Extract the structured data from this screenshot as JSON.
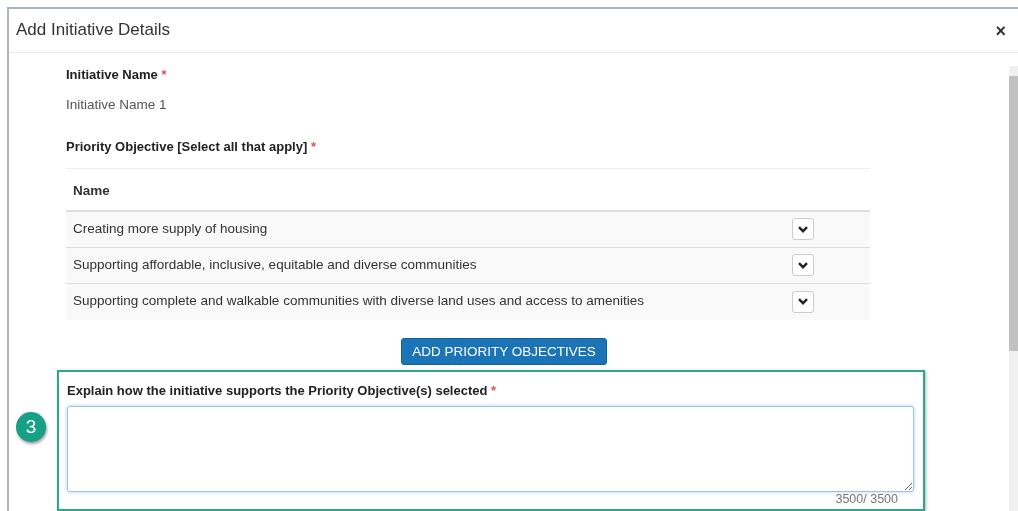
{
  "dialog": {
    "title": "Add Initiative Details",
    "close": "×"
  },
  "initiative_name": {
    "label": "Initiative Name",
    "required": true,
    "required_mark": "*",
    "value": "Initiative Name 1"
  },
  "priority_objective": {
    "label": "Priority Objective [Select all that apply]",
    "required": true,
    "required_mark": "*",
    "table": {
      "columns": [
        "Name"
      ],
      "rows": [
        {
          "name": "Creating more supply of housing"
        },
        {
          "name": "Supporting affordable, inclusive, equitable and diverse communities"
        },
        {
          "name": "Supporting complete and walkable communities with diverse land uses and access to amenities"
        }
      ]
    },
    "add_button": "ADD PRIORITY OBJECTIVES"
  },
  "explanation": {
    "callout_number": "3",
    "label": "Explain how the initiative supports the Priority Objective(s) selected",
    "required": true,
    "required_mark": "*",
    "focused": true,
    "counter": "3500/ 3500"
  }
}
